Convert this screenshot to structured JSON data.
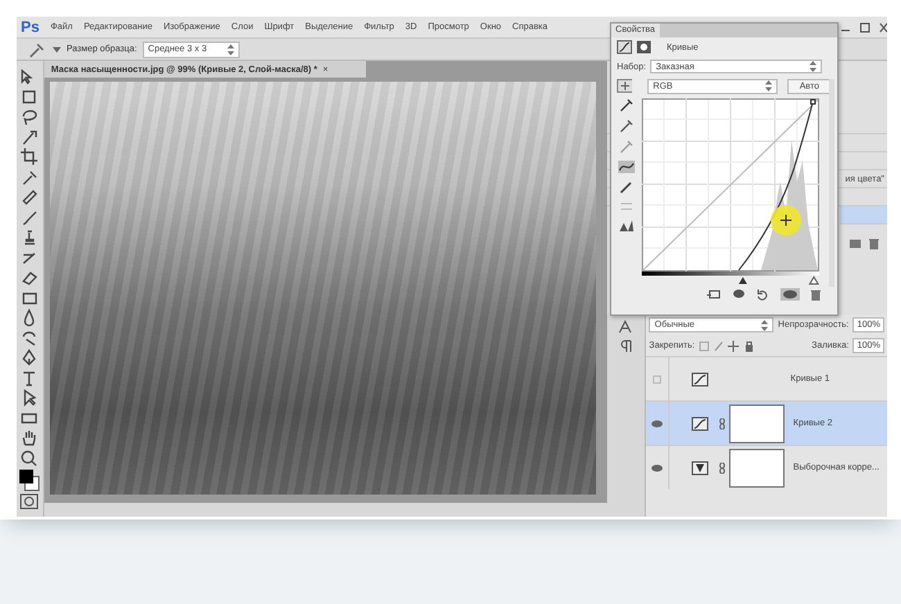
{
  "app_logo": "Ps",
  "menu": [
    "Файл",
    "Редактирование",
    "Изображение",
    "Слои",
    "Шрифт",
    "Выделение",
    "Фильтр",
    "3D",
    "Просмотр",
    "Окно",
    "Справка"
  ],
  "options_bar": {
    "label": "Размер образца:",
    "sample_size": "Среднее 3 х 3"
  },
  "document": {
    "tab_title": "Маска насыщенности.jpg @ 99% (Кривые 2, Слой-маска/8) *",
    "close": "×"
  },
  "properties": {
    "title": "Свойства",
    "adjustment": "Кривые",
    "preset_label": "Набор:",
    "preset": "Заказная",
    "channel": "RGB",
    "auto_button": "Авто",
    "input_sliders": [
      {
        "level": 0.57
      },
      {
        "level": 0.97
      }
    ]
  },
  "dock_text": "ия цвета\"",
  "layers": {
    "blend_mode": "Обычные",
    "opacity_label": "Непрозрачность:",
    "opacity": "100%",
    "lock_label": "Закрепить:",
    "fill_label": "Заливка:",
    "fill": "100%",
    "items": [
      {
        "name": "Кривые 1",
        "kind": "curves",
        "visible": false,
        "selected": false,
        "has_mask": false
      },
      {
        "name": "Кривые 2",
        "kind": "curves",
        "visible": true,
        "selected": true,
        "has_mask": true
      },
      {
        "name": "Выборочная корре...",
        "kind": "selective_color",
        "visible": true,
        "selected": false,
        "has_mask": true
      }
    ]
  }
}
